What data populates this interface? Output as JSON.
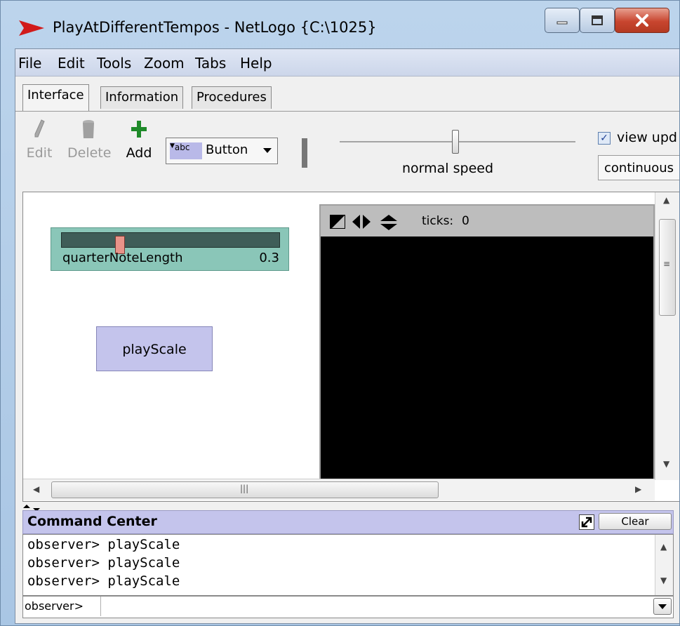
{
  "window": {
    "title": "PlayAtDifferentTempos - NetLogo {C:\\1025}",
    "accent_color": "#d11a1a",
    "close_color": "#c8452f"
  },
  "menu": [
    "File",
    "Edit",
    "Tools",
    "Zoom",
    "Tabs",
    "Help"
  ],
  "tabs": [
    {
      "label": "Interface",
      "active": true
    },
    {
      "label": "Information",
      "active": false
    },
    {
      "label": "Procedures",
      "active": false
    }
  ],
  "toolbar": {
    "edit_label": "Edit",
    "delete_label": "Delete",
    "add_label": "Add",
    "widget_type": "Button",
    "widget_icon_text": "abc",
    "speed_label": "normal speed",
    "speed_value": 0.5,
    "view_updates_label": "view upd",
    "view_updates_checked": true,
    "update_mode": "continuous"
  },
  "widgets": {
    "slider": {
      "name": "quarterNoteLength",
      "value": "0.3",
      "color": "#8ac6b8"
    },
    "button": {
      "label": "playScale",
      "color": "#c4c4ec"
    }
  },
  "view": {
    "ticks_label": "ticks:",
    "ticks_value": "0",
    "background": "#000000",
    "icons": [
      "settings-icon",
      "horizontal-resize-icon",
      "vertical-resize-icon"
    ]
  },
  "command_center": {
    "title": "Command Center",
    "clear_label": "Clear",
    "prompt": "observer>",
    "input_value": "",
    "log": [
      "observer> playScale",
      "observer> playScale",
      "observer> playScale"
    ]
  }
}
